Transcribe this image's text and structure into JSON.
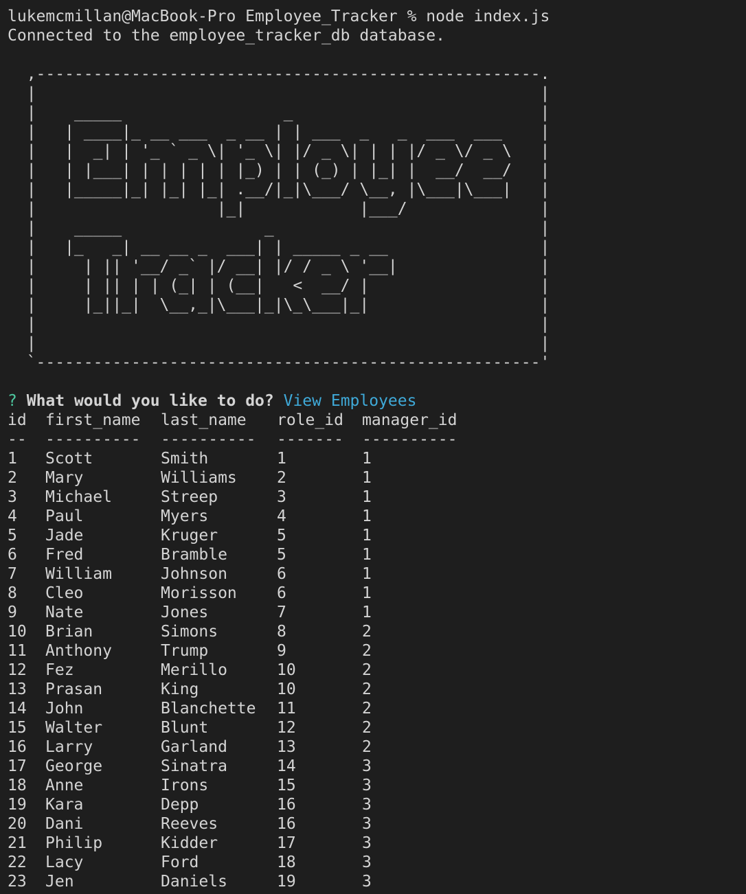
{
  "prompt": {
    "command_line": "lukemcmillan@MacBook-Pro Employee_Tracker % node index.js",
    "connected_message": "Connected to the employee_tracker_db database."
  },
  "banner": {
    "lines": [
      "  ,-----------------------------------------------------.",
      "  |                                                     |",
      "  |    _____                 _                          |",
      "  |   | ____|_ __ ___  _ __ | | ___  _   _  ___  ___    |",
      "  |   |  _| | '_ ` _ \\| '_ \\| |/ _ \\| | | |/ _ \\/ _ \\   |",
      "  |   | |___| | | | | | |_) | | (_) | |_| |  __/  __/   |",
      "  |   |_____|_| |_| |_| .__/|_|\\___/ \\__, |\\___|\\___|   |",
      "  |                   |_|            |___/              |",
      "  |    _____               _                            |",
      "  |   |_   _| __ __ _  ___| | _____ _ __                |",
      "  |     | || '__/ _` |/ __| |/ / _ \\ '__|               |",
      "  |     | || | | (_| | (__|   <  __/ |                  |",
      "  |     |_||_|  \\__,_|\\___|_|\\_\\___|_|                  |",
      "  |                                                     |",
      "  |                                                     |",
      "  `-----------------------------------------------------'"
    ]
  },
  "question": {
    "mark": "?",
    "text": "What would you like to do?",
    "answer": "View Employees"
  },
  "table": {
    "headers": [
      "id",
      "first_name",
      "last_name",
      "role_id",
      "manager_id"
    ],
    "separators": [
      "--",
      "----------",
      "----------",
      "-------",
      "----------"
    ],
    "rows": [
      [
        "1",
        "Scott",
        "Smith",
        "1",
        "1"
      ],
      [
        "2",
        "Mary",
        "Williams",
        "2",
        "1"
      ],
      [
        "3",
        "Michael",
        "Streep",
        "3",
        "1"
      ],
      [
        "4",
        "Paul",
        "Myers",
        "4",
        "1"
      ],
      [
        "5",
        "Jade",
        "Kruger",
        "5",
        "1"
      ],
      [
        "6",
        "Fred",
        "Bramble",
        "5",
        "1"
      ],
      [
        "7",
        "William",
        "Johnson",
        "6",
        "1"
      ],
      [
        "8",
        "Cleo",
        "Morisson",
        "6",
        "1"
      ],
      [
        "9",
        "Nate",
        "Jones",
        "7",
        "1"
      ],
      [
        "10",
        "Brian",
        "Simons",
        "8",
        "2"
      ],
      [
        "11",
        "Anthony",
        "Trump",
        "9",
        "2"
      ],
      [
        "12",
        "Fez",
        "Merillo",
        "10",
        "2"
      ],
      [
        "13",
        "Prasan",
        "King",
        "10",
        "2"
      ],
      [
        "14",
        "John",
        "Blanchette",
        "11",
        "2"
      ],
      [
        "15",
        "Walter",
        "Blunt",
        "12",
        "2"
      ],
      [
        "16",
        "Larry",
        "Garland",
        "13",
        "2"
      ],
      [
        "17",
        "George",
        "Sinatra",
        "14",
        "3"
      ],
      [
        "18",
        "Anne",
        "Irons",
        "15",
        "3"
      ],
      [
        "19",
        "Kara",
        "Depp",
        "16",
        "3"
      ],
      [
        "20",
        "Dani",
        "Reeves",
        "16",
        "3"
      ],
      [
        "21",
        "Philip",
        "Kidder",
        "17",
        "3"
      ],
      [
        "22",
        "Lacy",
        "Ford",
        "18",
        "3"
      ],
      [
        "23",
        "Jen",
        "Daniels",
        "19",
        "3"
      ]
    ]
  },
  "colors": {
    "background": "#1e1e1e",
    "text": "#d4d4d4",
    "question_mark": "#4ec9a0",
    "answer": "#3fa9d8"
  }
}
